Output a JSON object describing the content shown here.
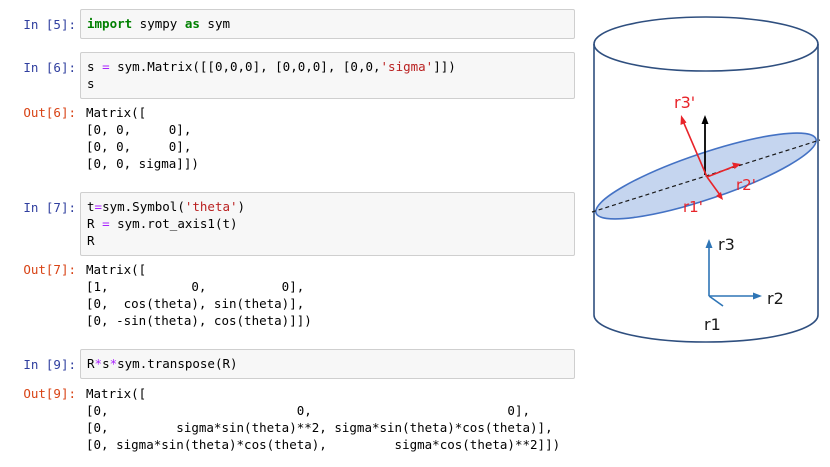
{
  "notebook": {
    "cells": [
      {
        "in_prompt": "In [5]:",
        "input_tokens": [
          [
            {
              "t": "import",
              "c": "kw"
            },
            {
              "t": " sympy ",
              "c": "tok"
            },
            {
              "t": "as",
              "c": "kw"
            },
            {
              "t": " sym",
              "c": "tok"
            }
          ]
        ],
        "out_prompt": "",
        "output_lines": []
      },
      {
        "in_prompt": "In [6]:",
        "input_tokens": [
          [
            {
              "t": "s ",
              "c": "tok"
            },
            {
              "t": "=",
              "c": "op"
            },
            {
              "t": " sym.Matrix([[0,0,0], [0,0,0], [0,0,",
              "c": "tok"
            },
            {
              "t": "'sigma'",
              "c": "str"
            },
            {
              "t": "]])",
              "c": "tok"
            }
          ],
          [
            {
              "t": "s",
              "c": "tok"
            }
          ]
        ],
        "out_prompt": "Out[6]:",
        "output_lines": [
          "Matrix([",
          "[0, 0,     0],",
          "[0, 0,     0],",
          "[0, 0, sigma]])"
        ]
      },
      {
        "in_prompt": "In [7]:",
        "input_tokens": [
          [
            {
              "t": "t",
              "c": "tok"
            },
            {
              "t": "=",
              "c": "op"
            },
            {
              "t": "sym.Symbol(",
              "c": "tok"
            },
            {
              "t": "'theta'",
              "c": "str"
            },
            {
              "t": ")",
              "c": "tok"
            }
          ],
          [
            {
              "t": "R ",
              "c": "tok"
            },
            {
              "t": "=",
              "c": "op"
            },
            {
              "t": " sym.rot_axis1(t)",
              "c": "tok"
            }
          ],
          [
            {
              "t": "R",
              "c": "tok"
            }
          ]
        ],
        "out_prompt": "Out[7]:",
        "output_lines": [
          "Matrix([",
          "[1,           0,          0],",
          "[0,  cos(theta), sin(theta)],",
          "[0, -sin(theta), cos(theta)]])"
        ]
      },
      {
        "in_prompt": "In [9]:",
        "input_tokens": [
          [
            {
              "t": "R",
              "c": "tok"
            },
            {
              "t": "*",
              "c": "op"
            },
            {
              "t": "s",
              "c": "tok"
            },
            {
              "t": "*",
              "c": "op"
            },
            {
              "t": "sym.transpose(R)",
              "c": "tok"
            }
          ]
        ],
        "out_prompt": "Out[9]:",
        "output_lines": [
          "Matrix([",
          "[0,                         0,                          0],",
          "[0,         sigma*sin(theta)**2, sigma*sin(theta)*cos(theta)],",
          "[0, sigma*sin(theta)*cos(theta),         sigma*cos(theta)**2]])"
        ]
      }
    ]
  },
  "figure": {
    "labels": {
      "r3_prime": "r3'",
      "r2_prime": "r2'",
      "r1_prime": "r1'",
      "r3": "r3",
      "r2": "r2",
      "r1": "r1"
    },
    "colors": {
      "ellipse_fill": "#c5d5ef",
      "ellipse_stroke": "#4472c4",
      "axis_blue": "#2e75b6",
      "prime_red": "#e8242a",
      "cylinder_stroke": "#2f4f7f"
    }
  }
}
